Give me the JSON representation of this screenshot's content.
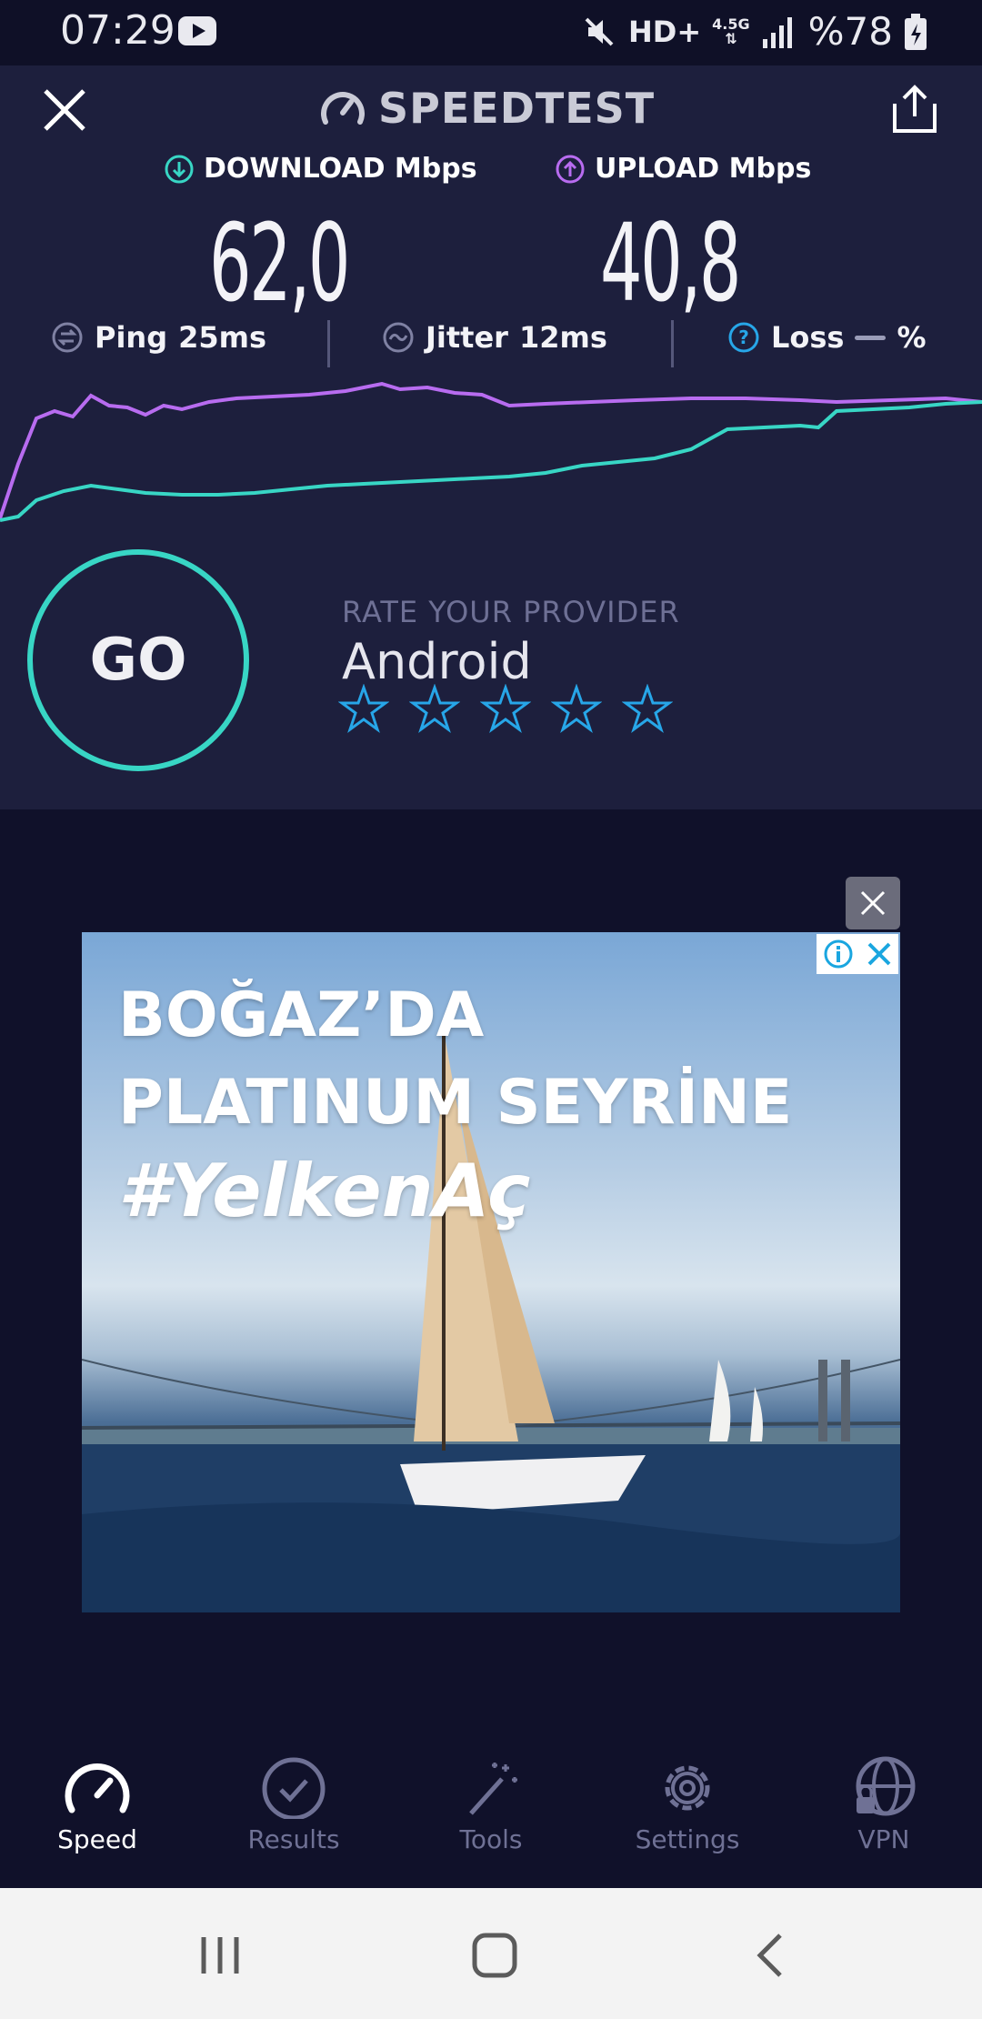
{
  "status_bar": {
    "time": "07:29",
    "hd_label": "HD+",
    "network_label": "4.5G",
    "battery": "%78"
  },
  "header": {
    "title": "SPEEDTEST"
  },
  "metrics": {
    "download_label": "DOWNLOAD Mbps",
    "download_value": "62,0",
    "upload_label": "UPLOAD Mbps",
    "upload_value": "40,8",
    "ping_label": "Ping",
    "ping_value": "25ms",
    "jitter_label": "Jitter",
    "jitter_value": "12ms",
    "loss_label": "Loss",
    "loss_value": "%"
  },
  "go_label": "GO",
  "rate": {
    "title": "RATE YOUR PROVIDER",
    "provider": "Android",
    "stars": 5
  },
  "ad": {
    "line1": "BOĞAZ’DA",
    "line2": "PLATINUM SEYRİNE",
    "line3": "#YelkenAç"
  },
  "tabs": [
    {
      "label": "Speed",
      "icon": "speedometer-icon",
      "active": true
    },
    {
      "label": "Results",
      "icon": "check-circle-icon",
      "active": false
    },
    {
      "label": "Tools",
      "icon": "magic-wand-icon",
      "active": false
    },
    {
      "label": "Settings",
      "icon": "gear-icon",
      "active": false
    },
    {
      "label": "VPN",
      "icon": "globe-lock-icon",
      "active": false
    }
  ],
  "colors": {
    "download": "#38d6c5",
    "upload": "#b86cf0",
    "star": "#27a6e8",
    "background": "#1d1f3d"
  }
}
